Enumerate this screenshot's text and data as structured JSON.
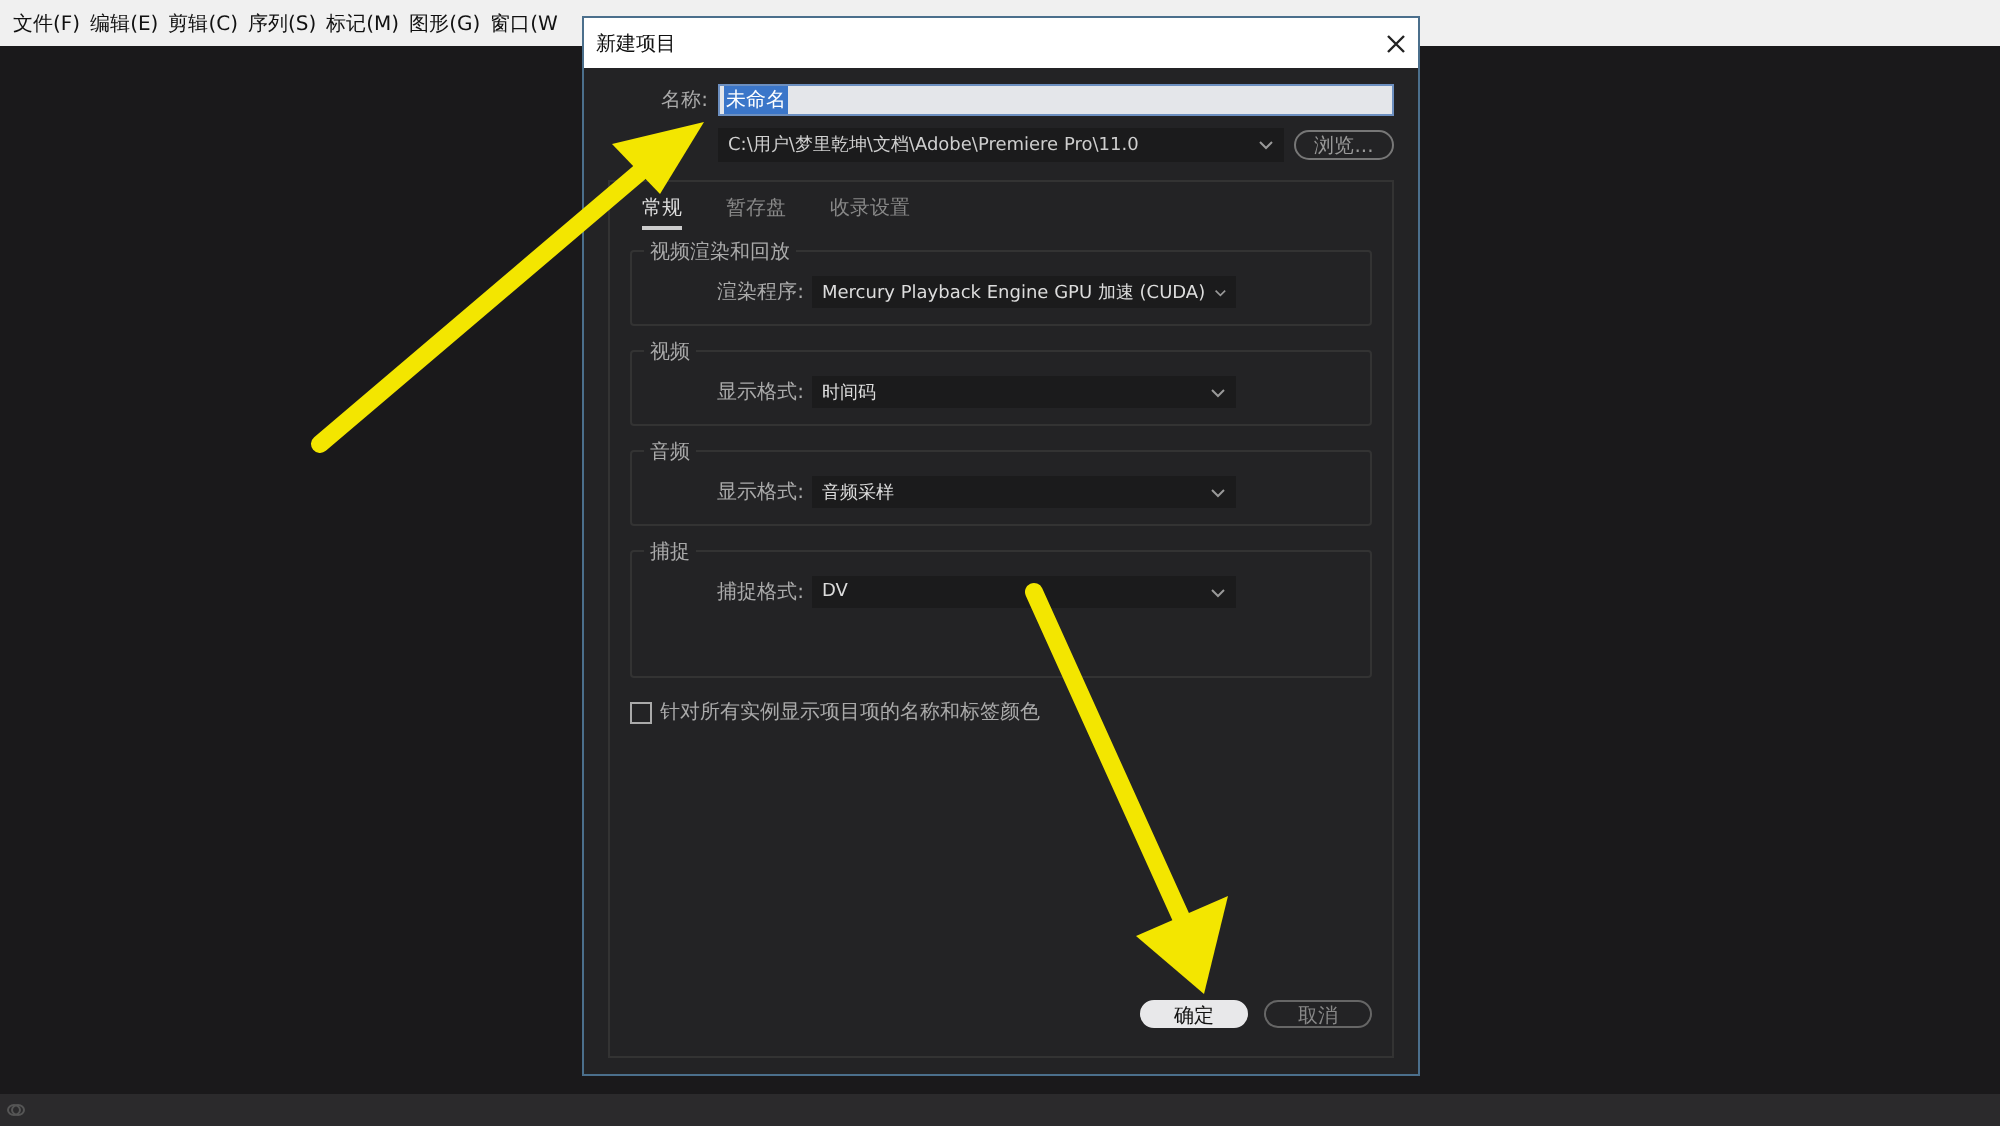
{
  "menu_bar": {
    "items": [
      "文件(F)",
      "编辑(E)",
      "剪辑(C)",
      "序列(S)",
      "标记(M)",
      "图形(G)",
      "窗口(W"
    ]
  },
  "dialog": {
    "title": "新建项目",
    "name_field": {
      "label": "名称:",
      "value": "未命名",
      "text_selected": true
    },
    "location_field": {
      "value": "C:\\用户\\梦里乾坤\\文档\\Adobe\\Premiere Pro\\11.0"
    },
    "browse_button": "浏览...",
    "tabs": [
      {
        "label": "常规",
        "selected": true
      },
      {
        "label": "暂存盘",
        "selected": false
      },
      {
        "label": "收录设置",
        "selected": false
      }
    ],
    "sections": [
      {
        "title": "视频渲染和回放",
        "label": "渲染程序:",
        "value": "Mercury Playback Engine GPU 加速 (CUDA)"
      },
      {
        "title": "视频",
        "label": "显示格式:",
        "value": "时间码"
      },
      {
        "title": "音频",
        "label": "显示格式:",
        "value": "音频采样"
      },
      {
        "title": "捕捉",
        "label": "捕捉格式:",
        "value": "DV"
      }
    ],
    "checkbox": {
      "label": "针对所有实例显示项目项的名称和标签颜色",
      "checked": false
    },
    "buttons": [
      {
        "label": "确定",
        "kind": "primary"
      },
      {
        "label": "取消",
        "kind": "secondary"
      }
    ]
  }
}
